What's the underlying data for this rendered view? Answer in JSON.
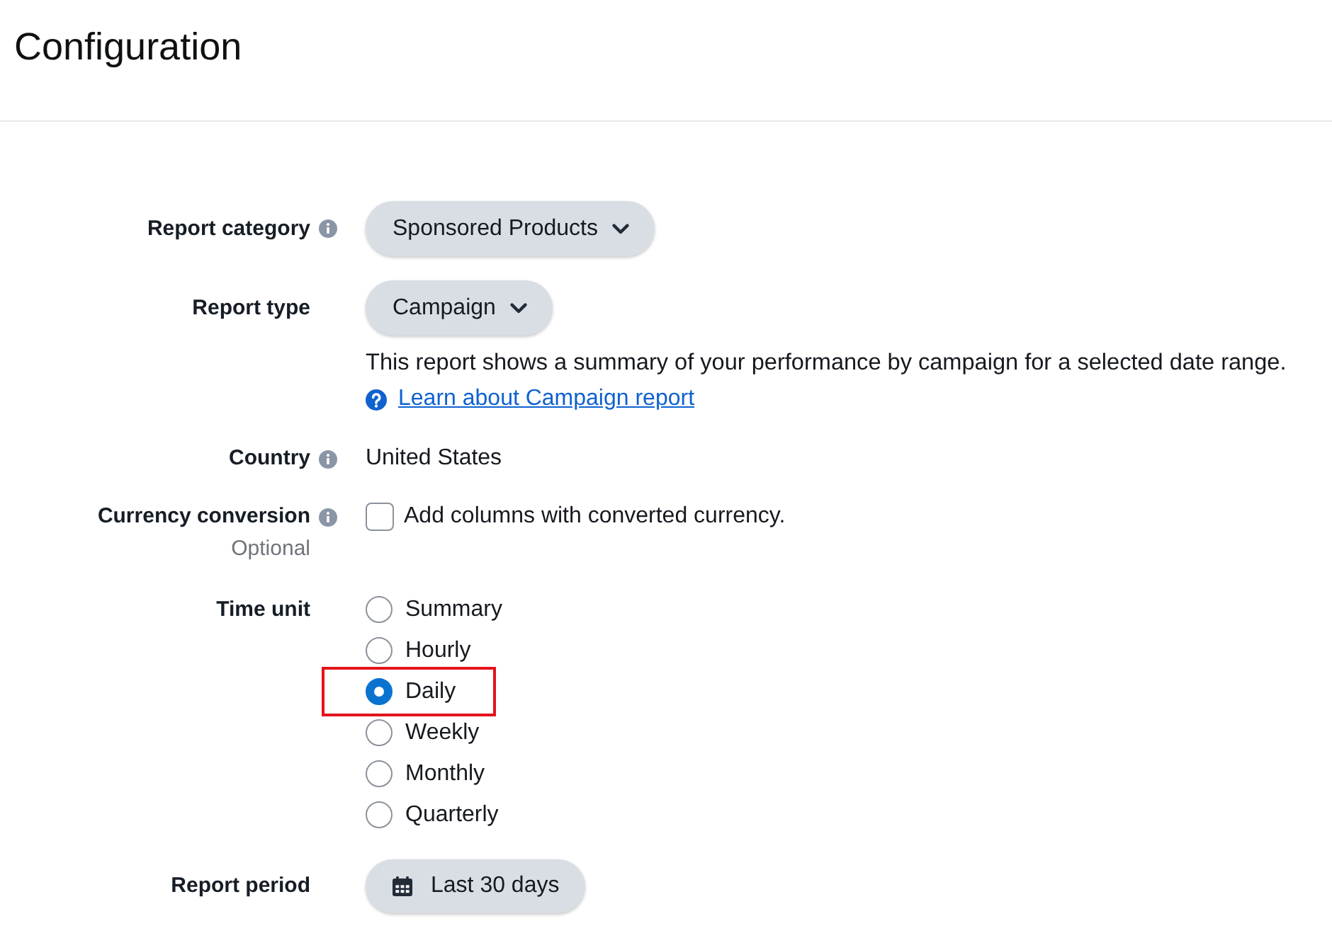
{
  "header": {
    "title": "Configuration"
  },
  "fields": [
    {
      "kind": "dropdown",
      "label": "Report category",
      "info": true,
      "value": "Sponsored Products"
    },
    {
      "kind": "dropdown",
      "label": "Report type",
      "info": false,
      "value": "Campaign",
      "description": "This report shows a summary of your performance by campaign for a selected date range.",
      "help_link": "Learn about Campaign report"
    },
    {
      "kind": "text",
      "label": "Country",
      "info": true,
      "value": "United States"
    },
    {
      "kind": "checkbox",
      "label": "Currency conversion",
      "info": true,
      "hint": "Optional",
      "checkbox": {
        "label": "Add columns with converted currency.",
        "checked": false
      }
    },
    {
      "kind": "radio",
      "label": "Time unit",
      "info": false,
      "options": [
        {
          "label": "Summary",
          "selected": false,
          "highlighted": false
        },
        {
          "label": "Hourly",
          "selected": false,
          "highlighted": false
        },
        {
          "label": "Daily",
          "selected": true,
          "highlighted": true
        },
        {
          "label": "Weekly",
          "selected": false,
          "highlighted": false
        },
        {
          "label": "Monthly",
          "selected": false,
          "highlighted": false
        },
        {
          "label": "Quarterly",
          "selected": false,
          "highlighted": false
        }
      ]
    },
    {
      "kind": "date",
      "label": "Report period",
      "info": false,
      "value": "Last 30 days"
    }
  ]
}
